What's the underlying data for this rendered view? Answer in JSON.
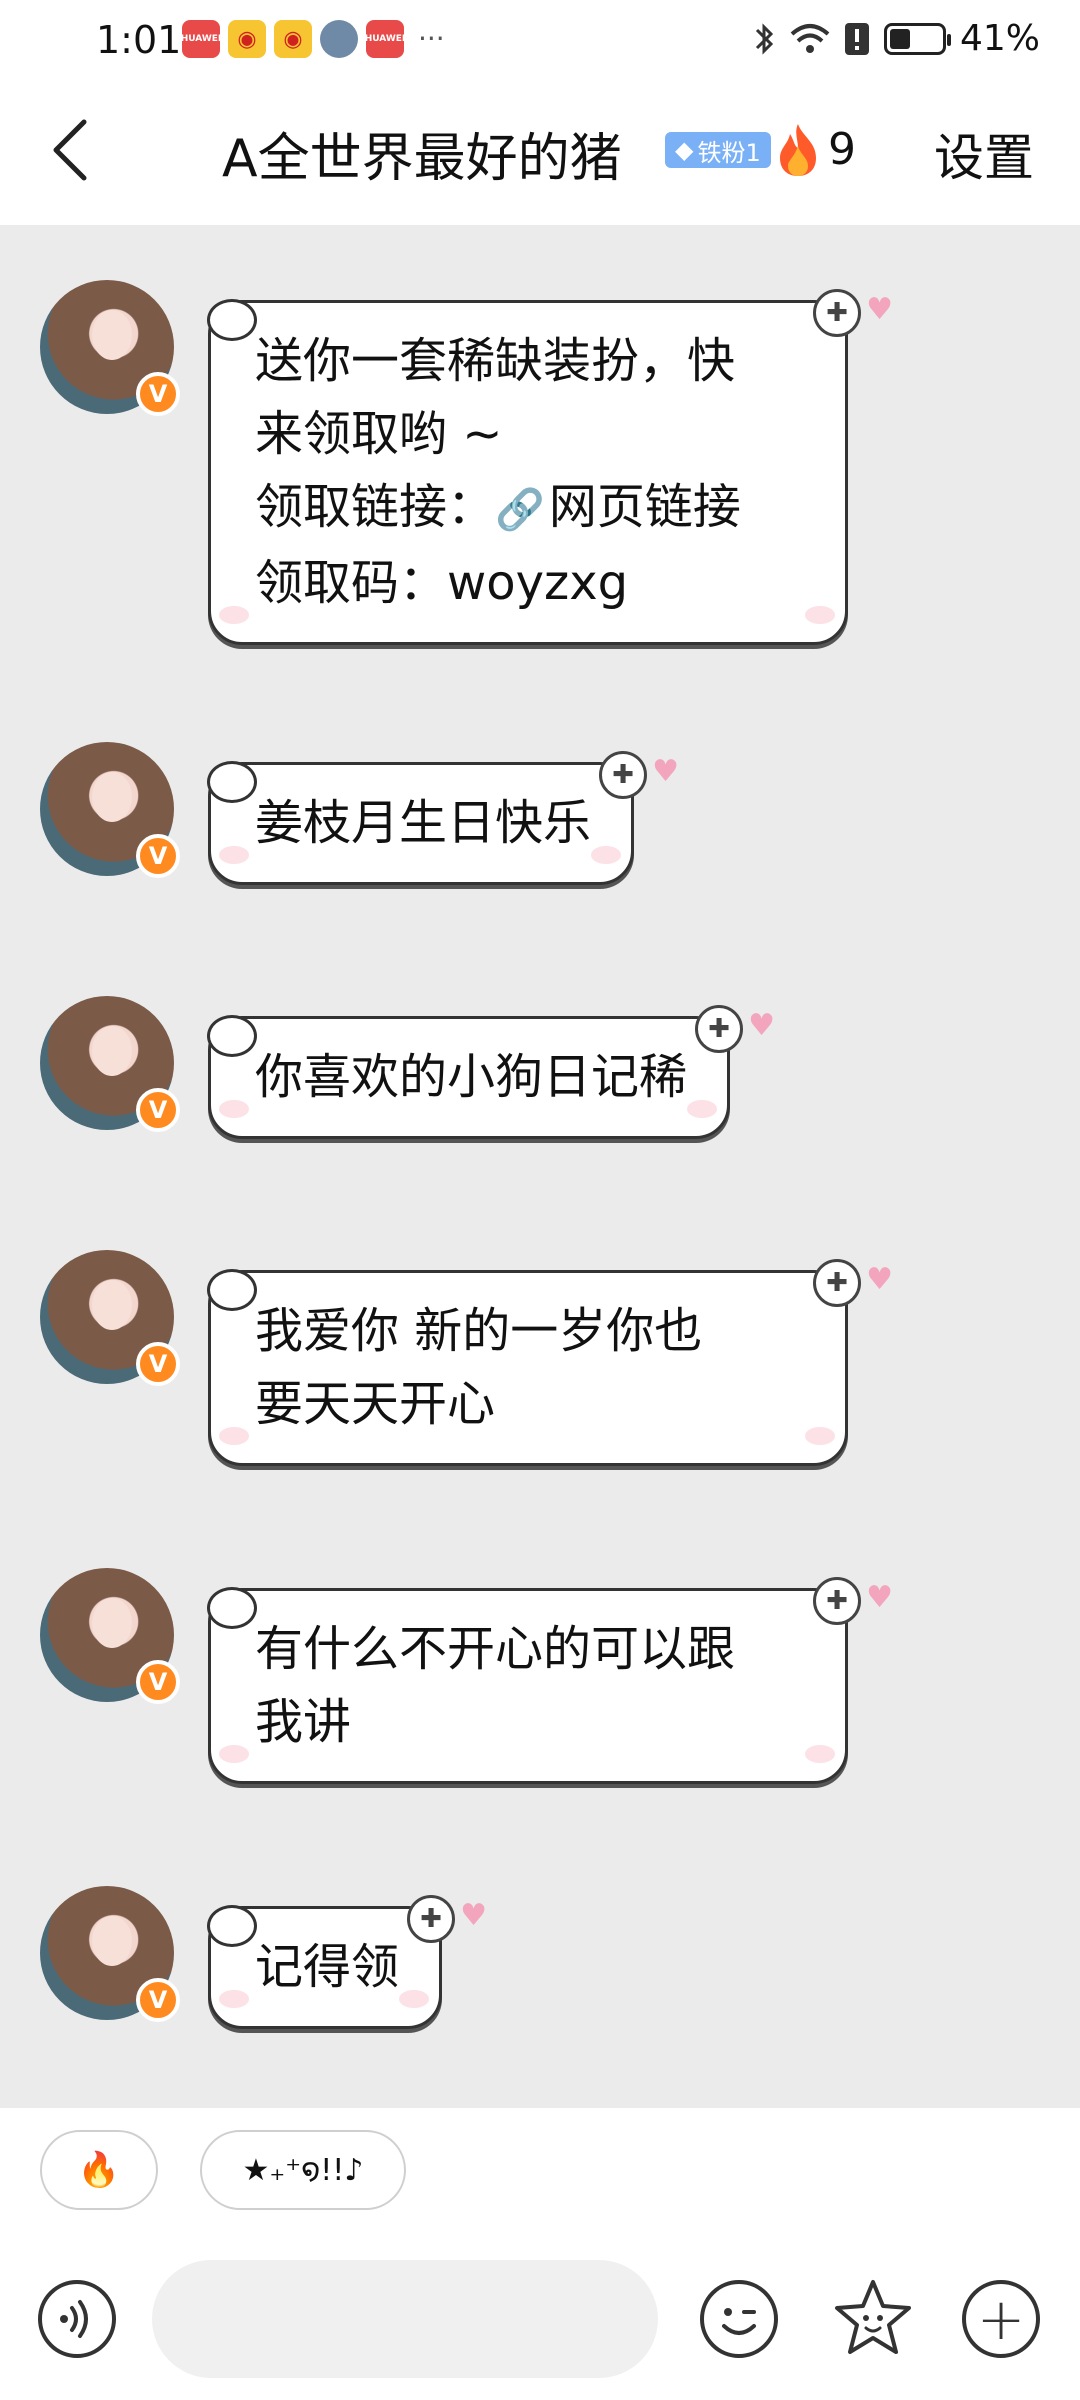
{
  "status_bar": {
    "time": "1:01",
    "notification_icons": [
      "huawei-appgallery-icon",
      "weibo-icon",
      "weibo-icon",
      "contact-avatar-icon",
      "huawei-appgallery-icon"
    ],
    "more": "···",
    "battery_text": "41%",
    "battery_level": 0.41
  },
  "header": {
    "title": "A全世界最好的猪",
    "fan_badge": "铁粉1",
    "fire_count": "9",
    "settings_label": "设置"
  },
  "messages": [
    {
      "lines": [
        "送你一套稀缺装扮，快",
        "来领取哟 ~",
        "领取链接：",
        "领取码：woyzxg"
      ],
      "link_text": "网页链接"
    },
    {
      "lines": [
        "姜枝月生日快乐"
      ]
    },
    {
      "lines": [
        "你喜欢的小狗日记稀"
      ]
    },
    {
      "lines": [
        "我爱你 新的一岁你也",
        "要天天开心"
      ]
    },
    {
      "lines": [
        "有什么不开心的可以跟",
        "我讲"
      ]
    },
    {
      "lines": [
        "记得领"
      ]
    }
  ],
  "quick_replies": [
    "🔥",
    "★₊⁺໑!!♪"
  ],
  "input": {
    "placeholder": ""
  },
  "colors": {
    "background": "#ebebeb",
    "verified_badge": "#ff8a1f",
    "fan_badge": "#7ab0f5",
    "link": "#4d7fd6"
  }
}
